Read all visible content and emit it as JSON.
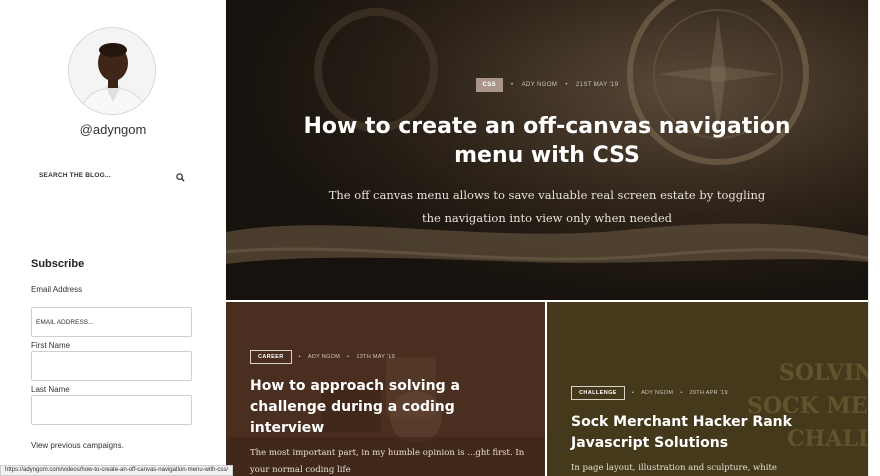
{
  "sidebar": {
    "handle": "@adyngom",
    "search_placeholder": "SEARCH THE BLOG...",
    "subscribe": {
      "title": "Subscribe",
      "email_label": "Email Address",
      "email_placeholder": "EMAIL ADDRESS...",
      "first_name_label": "First Name",
      "last_name_label": "Last Name",
      "view_previous": "View previous campaigns."
    }
  },
  "hero": {
    "tag": "CSS",
    "author": "ADY NGOM",
    "date": "21ST MAY '19",
    "title": "How to create an off-canvas navigation menu with CSS",
    "excerpt": "The off canvas menu allows to save valuable real screen estate by toggling the navigation into view only when needed"
  },
  "cards": [
    {
      "tag": "CAREER",
      "author": "ADY NGOM",
      "date": "13TH MAY '19",
      "title": "How to approach solving a challenge during a coding interview",
      "excerpt": "The most important part, in my humble opinion is ...ght first. In your normal coding life"
    },
    {
      "tag": "CHALLENGE",
      "author": "ADY NGOM",
      "date": "29TH APR '19",
      "title": "Sock Merchant Hacker Rank Javascript Solutions",
      "excerpt": "In page layout, illustration and sculpture, white",
      "bg_text": [
        "SOLVING",
        "SOCK MERCH",
        "CHALLE"
      ]
    }
  ],
  "status_bar": {
    "url": "https://adyngom.com/videos/how-to-create-an-off-canvas-navigation-menu-with-css/"
  },
  "colors": {
    "hero_bg": "#241c14",
    "card_left_bg": "#4a2e20",
    "card_right_bg": "#45391c",
    "tag_fill": "#a9958b"
  }
}
